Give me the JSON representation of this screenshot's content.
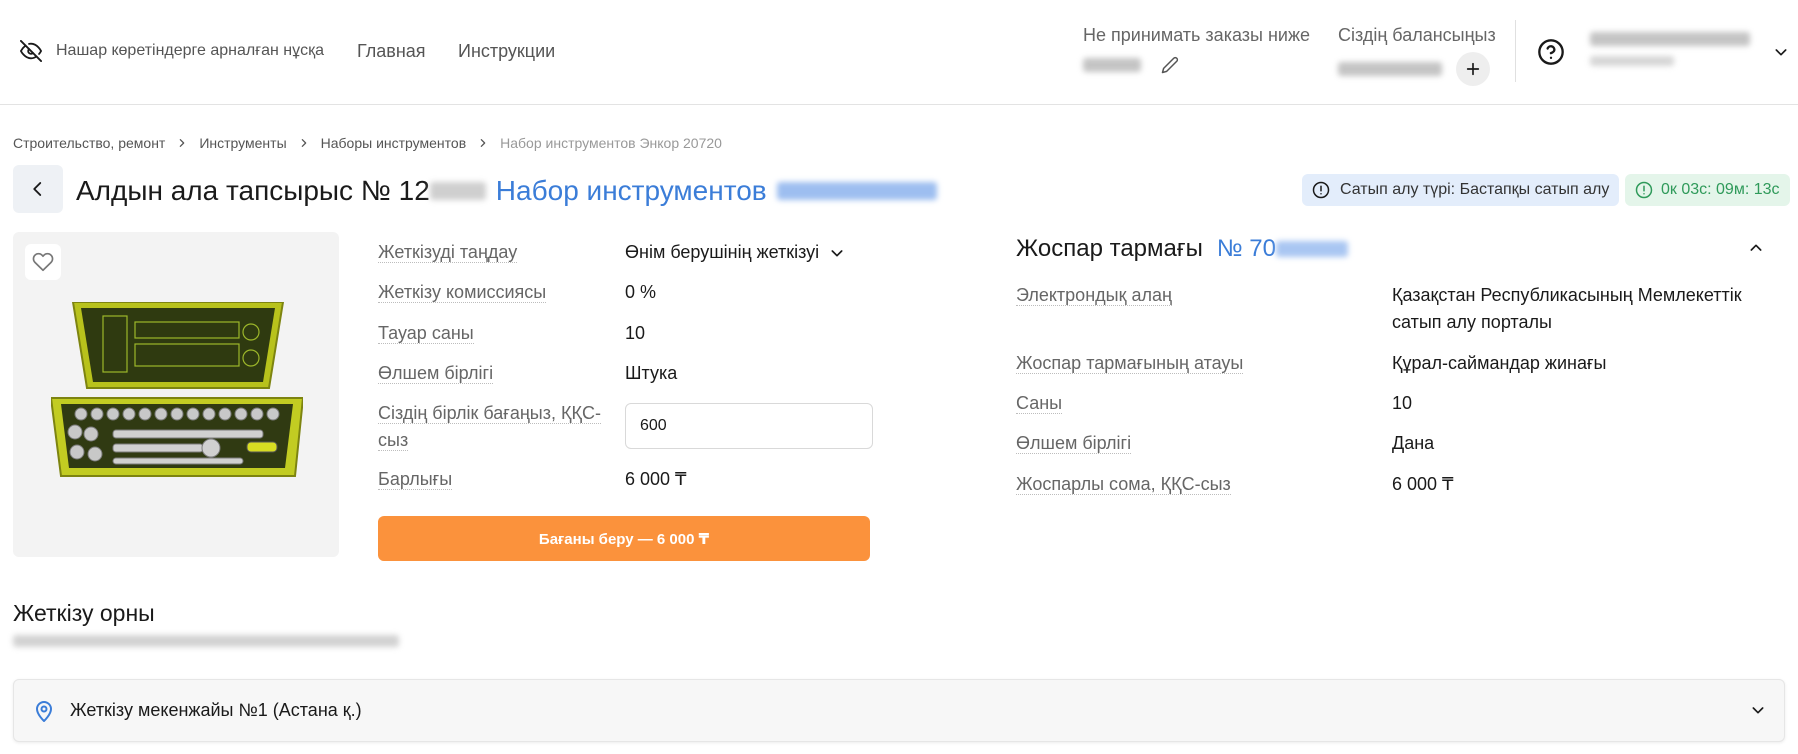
{
  "header": {
    "accessibility_label": "Нашар көретіндерге арналған нұсқа",
    "nav": [
      "Главная",
      "Инструкции"
    ],
    "min_order_label": "Не принимать заказы ниже",
    "balance_label": "Сіздің балансыңыз"
  },
  "breadcrumb": [
    "Строительство, ремонт",
    "Инструменты",
    "Наборы инструментов",
    "Набор инструментов Энкор 20720"
  ],
  "title": {
    "prefix": "Алдын ала тапсырыс № 12",
    "product_name": "Набор инструментов"
  },
  "badges": {
    "purchase_type": "Сатып алу түрі: Бастапқы сатып алу",
    "timer": "0к 03с: 09м: 13с"
  },
  "details": {
    "rows": [
      {
        "label": "Жеткізуді таңдау",
        "value": "Өнім берушінің жеткізуі"
      },
      {
        "label": "Жеткізу комиссиясы",
        "value": "0 %"
      },
      {
        "label": "Тауар саны",
        "value": "10"
      },
      {
        "label": "Өлшем бірлігі",
        "value": "Штука"
      },
      {
        "label": "Сіздің бірлік бағаңыз, ҚҚС-сыз",
        "value": "600"
      },
      {
        "label": "Барлығы",
        "value": "6 000 ₸"
      }
    ],
    "submit_label": "Бағаны беру — 6 000 ₸"
  },
  "plan": {
    "title": "Жоспар тармағы",
    "number_prefix": "№ 70",
    "rows": [
      {
        "label": "Электрондық алаң",
        "value": "Қазақстан Республикасының Мемлекеттік сатып алу порталы"
      },
      {
        "label": "Жоспар тармағының атауы",
        "value": "Құрал-саймандар жинағы"
      },
      {
        "label": "Саны",
        "value": "10"
      },
      {
        "label": "Өлшем бірлігі",
        "value": "Дана"
      },
      {
        "label": "Жоспарлы сома, ҚҚС-сыз",
        "value": "6 000 ₸"
      }
    ]
  },
  "delivery": {
    "title": "Жеткізу орны",
    "address_label": "Жеткізу мекенжайы №1 (Астана қ.)"
  },
  "icons": {
    "accessibility": "eye-off-icon",
    "edit": "pencil-icon",
    "add": "plus-icon",
    "help": "help-circle-icon",
    "back": "chevron-left-icon",
    "info": "info-circle-icon",
    "favorite": "heart-icon",
    "location": "map-pin-icon"
  },
  "colors": {
    "accent_blue": "#3b7dd8",
    "submit_orange": "#fb923c",
    "timer_green": "#2f9a5a",
    "badge_blue_bg": "#e3edfb"
  }
}
